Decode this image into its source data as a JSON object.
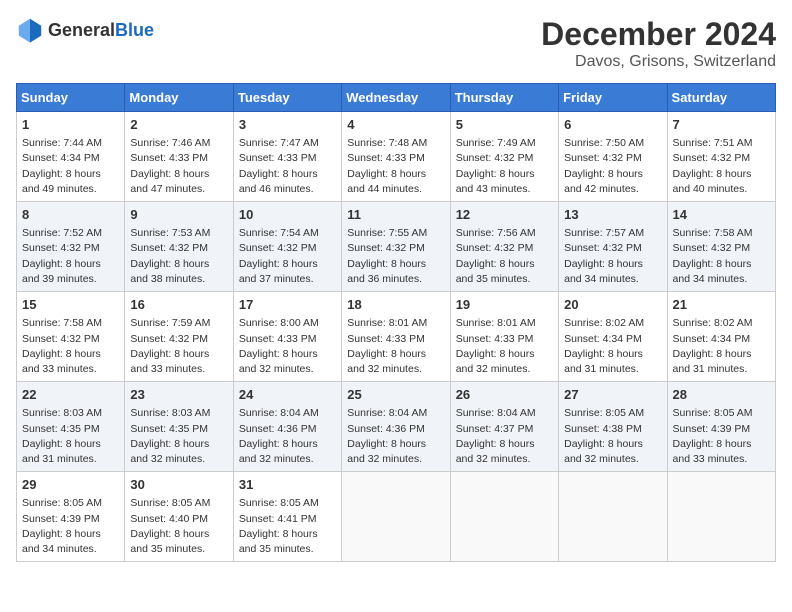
{
  "header": {
    "logo_general": "General",
    "logo_blue": "Blue",
    "month_title": "December 2024",
    "location": "Davos, Grisons, Switzerland"
  },
  "weekdays": [
    "Sunday",
    "Monday",
    "Tuesday",
    "Wednesday",
    "Thursday",
    "Friday",
    "Saturday"
  ],
  "weeks": [
    [
      {
        "day": "1",
        "sunrise": "Sunrise: 7:44 AM",
        "sunset": "Sunset: 4:34 PM",
        "daylight": "Daylight: 8 hours and 49 minutes."
      },
      {
        "day": "2",
        "sunrise": "Sunrise: 7:46 AM",
        "sunset": "Sunset: 4:33 PM",
        "daylight": "Daylight: 8 hours and 47 minutes."
      },
      {
        "day": "3",
        "sunrise": "Sunrise: 7:47 AM",
        "sunset": "Sunset: 4:33 PM",
        "daylight": "Daylight: 8 hours and 46 minutes."
      },
      {
        "day": "4",
        "sunrise": "Sunrise: 7:48 AM",
        "sunset": "Sunset: 4:33 PM",
        "daylight": "Daylight: 8 hours and 44 minutes."
      },
      {
        "day": "5",
        "sunrise": "Sunrise: 7:49 AM",
        "sunset": "Sunset: 4:32 PM",
        "daylight": "Daylight: 8 hours and 43 minutes."
      },
      {
        "day": "6",
        "sunrise": "Sunrise: 7:50 AM",
        "sunset": "Sunset: 4:32 PM",
        "daylight": "Daylight: 8 hours and 42 minutes."
      },
      {
        "day": "7",
        "sunrise": "Sunrise: 7:51 AM",
        "sunset": "Sunset: 4:32 PM",
        "daylight": "Daylight: 8 hours and 40 minutes."
      }
    ],
    [
      {
        "day": "8",
        "sunrise": "Sunrise: 7:52 AM",
        "sunset": "Sunset: 4:32 PM",
        "daylight": "Daylight: 8 hours and 39 minutes."
      },
      {
        "day": "9",
        "sunrise": "Sunrise: 7:53 AM",
        "sunset": "Sunset: 4:32 PM",
        "daylight": "Daylight: 8 hours and 38 minutes."
      },
      {
        "day": "10",
        "sunrise": "Sunrise: 7:54 AM",
        "sunset": "Sunset: 4:32 PM",
        "daylight": "Daylight: 8 hours and 37 minutes."
      },
      {
        "day": "11",
        "sunrise": "Sunrise: 7:55 AM",
        "sunset": "Sunset: 4:32 PM",
        "daylight": "Daylight: 8 hours and 36 minutes."
      },
      {
        "day": "12",
        "sunrise": "Sunrise: 7:56 AM",
        "sunset": "Sunset: 4:32 PM",
        "daylight": "Daylight: 8 hours and 35 minutes."
      },
      {
        "day": "13",
        "sunrise": "Sunrise: 7:57 AM",
        "sunset": "Sunset: 4:32 PM",
        "daylight": "Daylight: 8 hours and 34 minutes."
      },
      {
        "day": "14",
        "sunrise": "Sunrise: 7:58 AM",
        "sunset": "Sunset: 4:32 PM",
        "daylight": "Daylight: 8 hours and 34 minutes."
      }
    ],
    [
      {
        "day": "15",
        "sunrise": "Sunrise: 7:58 AM",
        "sunset": "Sunset: 4:32 PM",
        "daylight": "Daylight: 8 hours and 33 minutes."
      },
      {
        "day": "16",
        "sunrise": "Sunrise: 7:59 AM",
        "sunset": "Sunset: 4:32 PM",
        "daylight": "Daylight: 8 hours and 33 minutes."
      },
      {
        "day": "17",
        "sunrise": "Sunrise: 8:00 AM",
        "sunset": "Sunset: 4:33 PM",
        "daylight": "Daylight: 8 hours and 32 minutes."
      },
      {
        "day": "18",
        "sunrise": "Sunrise: 8:01 AM",
        "sunset": "Sunset: 4:33 PM",
        "daylight": "Daylight: 8 hours and 32 minutes."
      },
      {
        "day": "19",
        "sunrise": "Sunrise: 8:01 AM",
        "sunset": "Sunset: 4:33 PM",
        "daylight": "Daylight: 8 hours and 32 minutes."
      },
      {
        "day": "20",
        "sunrise": "Sunrise: 8:02 AM",
        "sunset": "Sunset: 4:34 PM",
        "daylight": "Daylight: 8 hours and 31 minutes."
      },
      {
        "day": "21",
        "sunrise": "Sunrise: 8:02 AM",
        "sunset": "Sunset: 4:34 PM",
        "daylight": "Daylight: 8 hours and 31 minutes."
      }
    ],
    [
      {
        "day": "22",
        "sunrise": "Sunrise: 8:03 AM",
        "sunset": "Sunset: 4:35 PM",
        "daylight": "Daylight: 8 hours and 31 minutes."
      },
      {
        "day": "23",
        "sunrise": "Sunrise: 8:03 AM",
        "sunset": "Sunset: 4:35 PM",
        "daylight": "Daylight: 8 hours and 32 minutes."
      },
      {
        "day": "24",
        "sunrise": "Sunrise: 8:04 AM",
        "sunset": "Sunset: 4:36 PM",
        "daylight": "Daylight: 8 hours and 32 minutes."
      },
      {
        "day": "25",
        "sunrise": "Sunrise: 8:04 AM",
        "sunset": "Sunset: 4:36 PM",
        "daylight": "Daylight: 8 hours and 32 minutes."
      },
      {
        "day": "26",
        "sunrise": "Sunrise: 8:04 AM",
        "sunset": "Sunset: 4:37 PM",
        "daylight": "Daylight: 8 hours and 32 minutes."
      },
      {
        "day": "27",
        "sunrise": "Sunrise: 8:05 AM",
        "sunset": "Sunset: 4:38 PM",
        "daylight": "Daylight: 8 hours and 32 minutes."
      },
      {
        "day": "28",
        "sunrise": "Sunrise: 8:05 AM",
        "sunset": "Sunset: 4:39 PM",
        "daylight": "Daylight: 8 hours and 33 minutes."
      }
    ],
    [
      {
        "day": "29",
        "sunrise": "Sunrise: 8:05 AM",
        "sunset": "Sunset: 4:39 PM",
        "daylight": "Daylight: 8 hours and 34 minutes."
      },
      {
        "day": "30",
        "sunrise": "Sunrise: 8:05 AM",
        "sunset": "Sunset: 4:40 PM",
        "daylight": "Daylight: 8 hours and 35 minutes."
      },
      {
        "day": "31",
        "sunrise": "Sunrise: 8:05 AM",
        "sunset": "Sunset: 4:41 PM",
        "daylight": "Daylight: 8 hours and 35 minutes."
      },
      null,
      null,
      null,
      null
    ]
  ]
}
